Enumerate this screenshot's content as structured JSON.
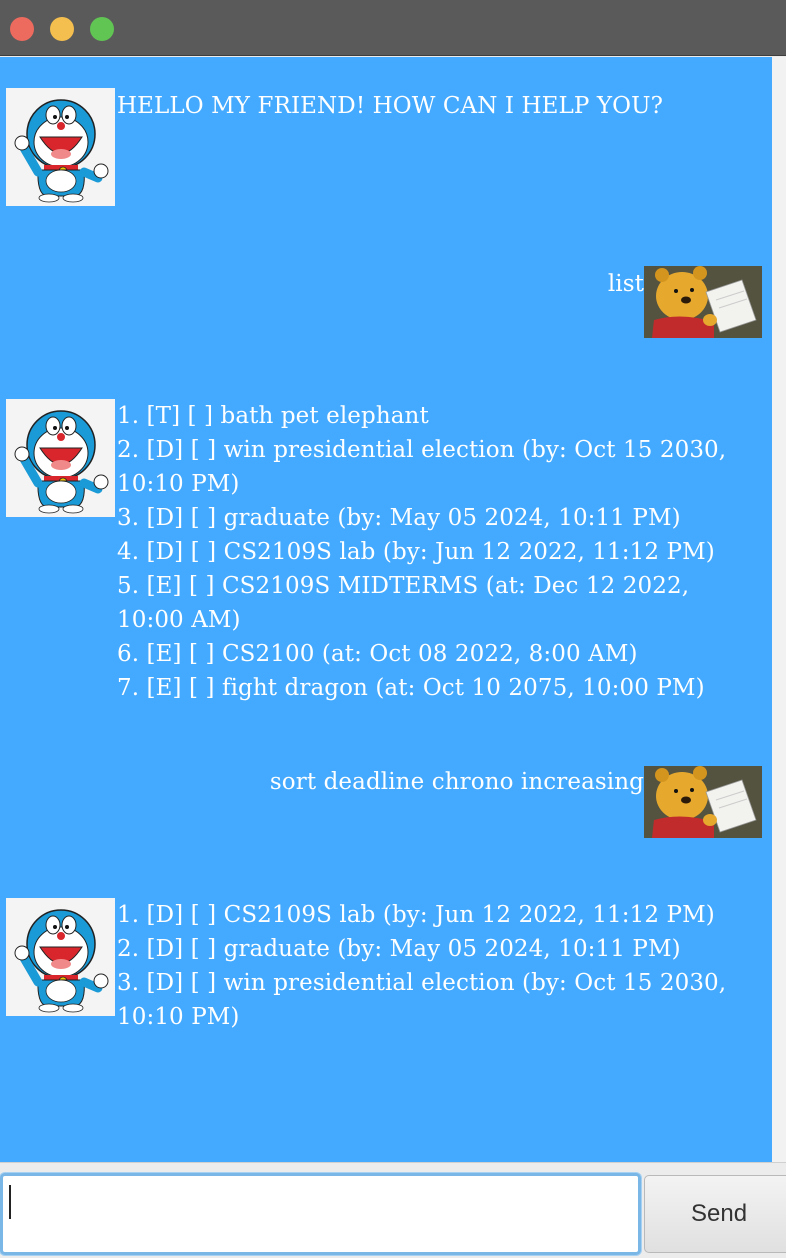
{
  "window": {
    "controls": [
      "close",
      "minimize",
      "maximize"
    ]
  },
  "colors": {
    "chat_background": "#44aaff",
    "message_text": "#ffffff"
  },
  "messages": [
    {
      "sender": "bot",
      "avatar": "doraemon-avatar",
      "text": "HELLO MY FRIEND! HOW CAN I HELP YOU?"
    },
    {
      "sender": "user",
      "avatar": "pooh-avatar",
      "text": "list"
    },
    {
      "sender": "bot",
      "avatar": "doraemon-avatar",
      "text": "1. [T] [ ] bath pet elephant\n2. [D] [ ] win presidential election (by: Oct 15 2030,\n10:10 PM)\n3. [D] [ ] graduate (by: May 05 2024, 10:11 PM)\n4. [D] [ ] CS2109S lab (by: Jun 12 2022, 11:12 PM)\n5. [E] [ ] CS2109S MIDTERMS (at: Dec 12 2022,\n10:00 AM)\n6. [E] [ ] CS2100 (at: Oct 08 2022, 8:00 AM)\n7. [E] [ ] fight dragon (at: Oct 10 2075, 10:00 PM)"
    },
    {
      "sender": "user",
      "avatar": "pooh-avatar",
      "text": "sort deadline chrono increasing"
    },
    {
      "sender": "bot",
      "avatar": "doraemon-avatar",
      "text": "1. [D] [ ] CS2109S lab (by: Jun 12 2022, 11:12 PM)\n2. [D] [ ] graduate (by: May 05 2024, 10:11 PM)\n3. [D] [ ] win presidential election (by: Oct 15 2030,\n10:10 PM)"
    }
  ],
  "input": {
    "value": "",
    "placeholder": ""
  },
  "send_button": {
    "label": "Send"
  }
}
